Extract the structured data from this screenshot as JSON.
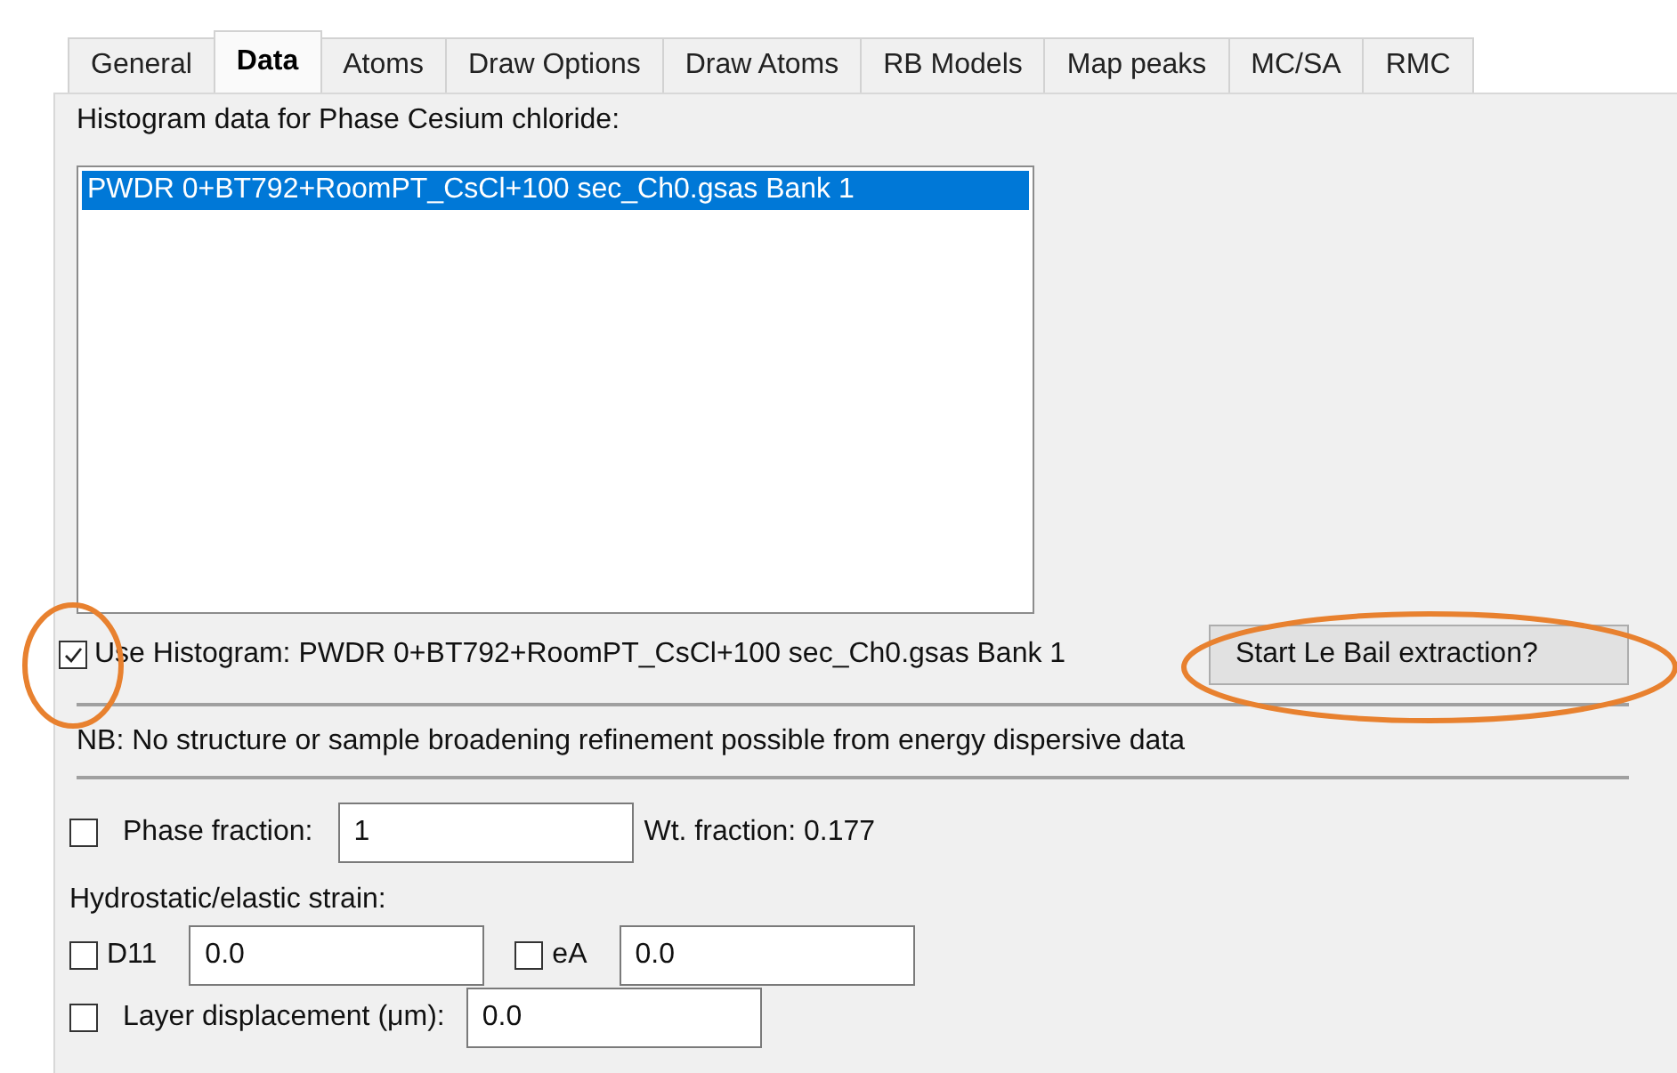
{
  "tabs": [
    {
      "label": "General",
      "selected": false
    },
    {
      "label": "Data",
      "selected": true
    },
    {
      "label": "Atoms",
      "selected": false
    },
    {
      "label": "Draw Options",
      "selected": false
    },
    {
      "label": "Draw Atoms",
      "selected": false
    },
    {
      "label": "RB Models",
      "selected": false
    },
    {
      "label": "Map peaks",
      "selected": false
    },
    {
      "label": "MC/SA",
      "selected": false
    },
    {
      "label": "RMC",
      "selected": false
    }
  ],
  "heading": "Histogram data for Phase Cesium chloride:",
  "histograms": [
    {
      "label": "PWDR 0+BT792+RoomPT_CsCl+100 sec_Ch0.gsas Bank 1",
      "selected": true
    }
  ],
  "use_histogram": {
    "label": "Use Histogram: PWDR 0+BT792+RoomPT_CsCl+100 sec_Ch0.gsas Bank 1",
    "checked": true
  },
  "le_bail_button": "Start Le Bail extraction?",
  "note": "NB: No structure or sample broadening refinement possible from energy dispersive data",
  "phase_fraction": {
    "label": "Phase fraction:",
    "checked": false,
    "value": "1",
    "wt_fraction": "Wt. fraction: 0.177"
  },
  "strain_heading": "Hydrostatic/elastic strain:",
  "strain": [
    {
      "label": "D11",
      "checked": false,
      "value": "0.0"
    },
    {
      "label": "eA",
      "checked": false,
      "value": "0.0"
    }
  ],
  "layer_displacement": {
    "label": "Layer displacement (μm):",
    "checked": false,
    "value": "0.0"
  }
}
